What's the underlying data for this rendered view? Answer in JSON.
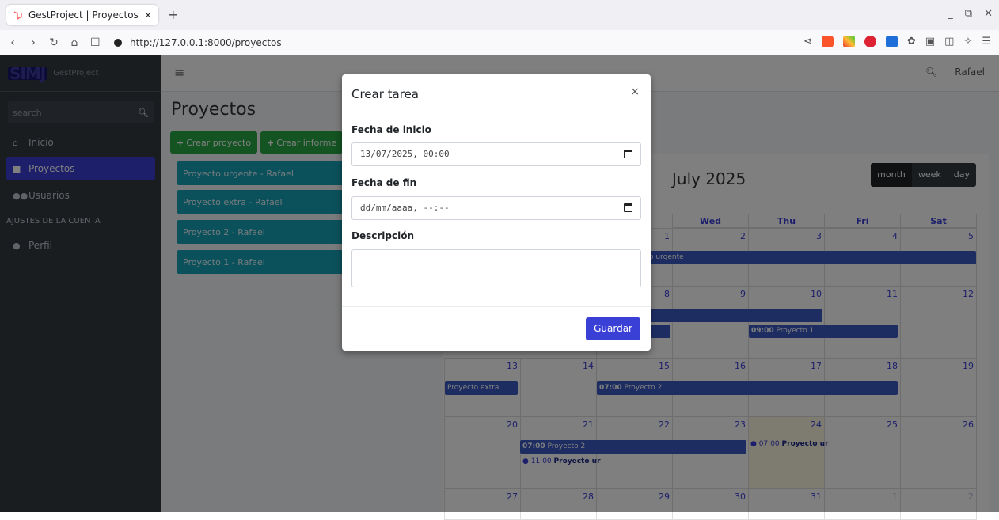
{
  "browser": {
    "tab_title": "GestProject | Proyectos",
    "tab_close": "×",
    "new_tab": "+",
    "url": "http://127.0.0.1:8000/proyectos",
    "window_controls": [
      "_",
      "⧉",
      "✕"
    ]
  },
  "sidebar": {
    "brand_logo": "SIMJ",
    "brand_text": "GestProject",
    "search_placeholder": "search",
    "items": [
      {
        "label": "Inicio",
        "icon": "home-icon"
      },
      {
        "label": "Proyectos",
        "icon": "briefcase-icon"
      },
      {
        "label": "Usuarios",
        "icon": "users-icon"
      }
    ],
    "section_header": "AJUSTES DE LA CUENTA",
    "profile": {
      "label": "Perfil",
      "icon": "user-icon"
    }
  },
  "topbar": {
    "user": "Rafael"
  },
  "page": {
    "title": "Proyectos",
    "create_project": "Crear proyecto",
    "create_report": "Crear informe",
    "projects": [
      "Proyecto urgente - Rafael",
      "Proyecto extra - Rafael",
      "Proyecto 2 - Rafael",
      "Proyecto 1 - Rafael"
    ]
  },
  "calendar": {
    "title": "July 2025",
    "views": [
      "month",
      "week",
      "day"
    ],
    "weekdays": [
      "Wed",
      "Thu",
      "Fri",
      "Sat"
    ],
    "weeks": [
      [
        "1",
        "2",
        "3",
        "4",
        "5"
      ],
      [
        "8",
        "9",
        "10",
        "11",
        "12"
      ],
      [
        "13",
        "14",
        "15",
        "16",
        "17",
        "18",
        "19"
      ],
      [
        "20",
        "21",
        "22",
        "23",
        "24",
        "25",
        "26"
      ],
      [
        "27",
        "28",
        "29",
        "30",
        "31",
        "1",
        "2"
      ]
    ],
    "events": {
      "urgente_fragment": "o urgente",
      "p1_time": "09:00",
      "p1_label": "Proyecto 1",
      "extra": "Proyecto extra",
      "p2_time": "07:00",
      "p2_label": "Proyecto 2",
      "p2b_time": "07:00",
      "p2b_label": "Proyecto 2",
      "ur1_time": "11:00",
      "ur1_label": "Proyecto ur",
      "ur2_time": "07:00",
      "ur2_label": "Proyecto ur"
    },
    "colors": {
      "event": "#3b5bc4",
      "today": "#fcf8e3",
      "accent": "#3a3fd6"
    }
  },
  "modal": {
    "title": "Crear tarea",
    "close": "×",
    "start_label": "Fecha de inicio",
    "start_value": "13/07/2025, 00:00",
    "end_label": "Fecha de fin",
    "end_placeholder": "dd/mm/aaaa, --:--",
    "desc_label": "Descripción",
    "save": "Guardar"
  }
}
